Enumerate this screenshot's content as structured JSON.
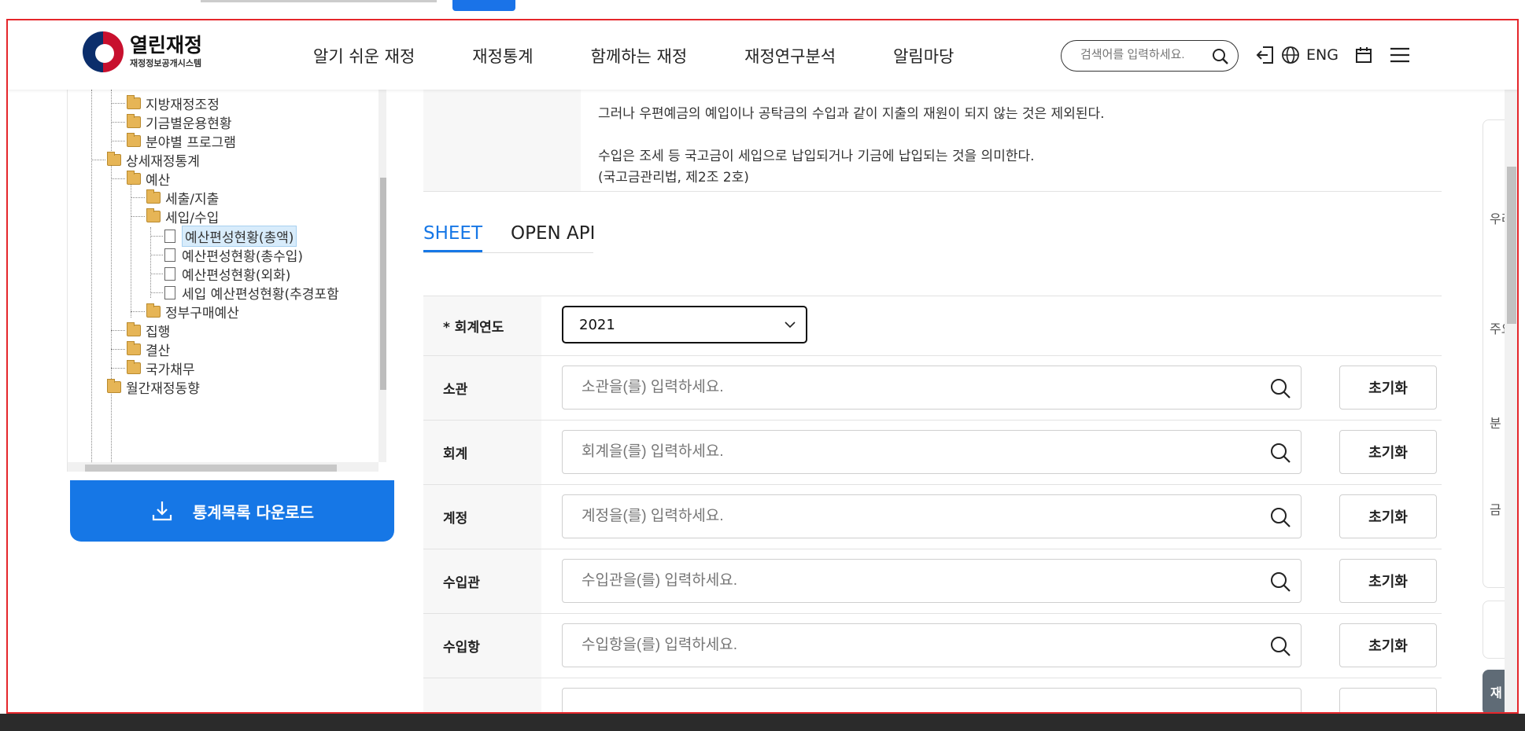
{
  "header": {
    "logo_title": "열린재정",
    "logo_sub": "재정정보공개시스템",
    "nav": [
      "알기 쉬운 재정",
      "재정통계",
      "함께하는 재정",
      "재정연구분석",
      "알림마당"
    ],
    "search_placeholder": "검색어를 입력하세요.",
    "lang": "ENG"
  },
  "tree": {
    "nodes": [
      {
        "label": "지방재정조정",
        "type": "folder"
      },
      {
        "label": "기금별운용현황",
        "type": "folder"
      },
      {
        "label": "분야별 프로그램",
        "type": "folder"
      },
      {
        "label": "상세재정통계",
        "type": "folder"
      },
      {
        "label": "예산",
        "type": "folder"
      },
      {
        "label": "세출/지출",
        "type": "folder"
      },
      {
        "label": "세입/수입",
        "type": "folder"
      },
      {
        "label": "예산편성현황(총액)",
        "type": "doc"
      },
      {
        "label": "예산편성현황(총수입)",
        "type": "doc"
      },
      {
        "label": "예산편성현황(외화)",
        "type": "doc"
      },
      {
        "label": "세입 예산편성현황(추경포함",
        "type": "doc"
      },
      {
        "label": "정부구매예산",
        "type": "folder"
      },
      {
        "label": "집행",
        "type": "folder"
      },
      {
        "label": "결산",
        "type": "folder"
      },
      {
        "label": "국가채무",
        "type": "folder"
      },
      {
        "label": "월간재정동향",
        "type": "folder"
      }
    ],
    "download_label": "통계목록 다운로드"
  },
  "description": {
    "lines": [
      "그러나 우편예금의 예입이나 공탁금의 수입과 같이 지출의 재원이 되지 않는 것은 제외된다.",
      "수입은 조세 등 국고금이 세입으로 납입되거나 기금에 납입되는 것을 의미한다.",
      "(국고금관리법, 제2조 2호)"
    ]
  },
  "tabs": [
    "SHEET",
    "OPEN API"
  ],
  "form": {
    "year_label": "* 회계연도",
    "year_value": "2021",
    "reset_label": "초기화",
    "fields": [
      {
        "label": "소관",
        "placeholder": "소관을(를) 입력하세요."
      },
      {
        "label": "회계",
        "placeholder": "회계을(를) 입력하세요."
      },
      {
        "label": "계정",
        "placeholder": "계정을(를) 입력하세요."
      },
      {
        "label": "수입관",
        "placeholder": "수입관을(를) 입력하세요."
      },
      {
        "label": "수입항",
        "placeholder": "수입항을(를) 입력하세요."
      }
    ]
  },
  "side": {
    "labels": [
      "우리",
      "주요",
      "분",
      "금"
    ],
    "float_label": "재"
  }
}
